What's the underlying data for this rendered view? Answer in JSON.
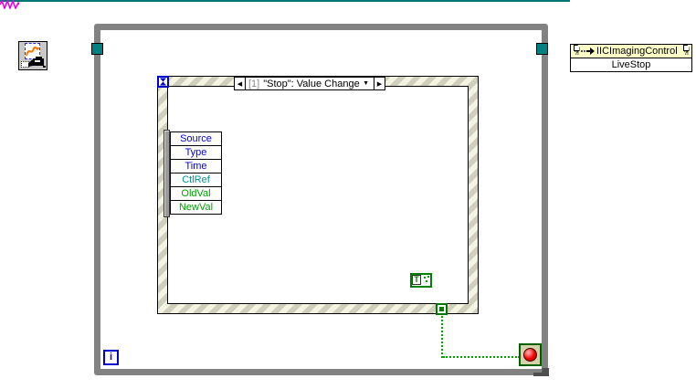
{
  "colors": {
    "refnum_wire_teal": "#007878",
    "cluster_wire_magenta": "#e800e8",
    "boolean_wire_green": "#00a300",
    "loop_border_gray": "#828282",
    "event_border_cream": "#f4f4e3",
    "event_border_stripe": "#cfcfbb",
    "invoke_header_yellow": "#ffffc8",
    "stop_button_red": "#f00000",
    "terminal_blue": "#0000cc"
  },
  "while_loop": {
    "iteration_label": "i"
  },
  "event_structure": {
    "selector": {
      "prev": "◀",
      "index": "[1]",
      "label": "\"Stop\": Value Change",
      "dropdown": "▼",
      "next": "▶"
    },
    "data_node": {
      "fields": [
        {
          "label": "Source",
          "color": "#0000e6"
        },
        {
          "label": "Type",
          "color": "#0000e6"
        },
        {
          "label": "Time",
          "color": "#0000e6"
        },
        {
          "label": "CtlRef",
          "color": "#009595"
        },
        {
          "label": "OldVal",
          "color": "#00a000"
        },
        {
          "label": "NewVal",
          "color": "#00a000"
        }
      ]
    }
  },
  "boolean_constant": {
    "value": "T"
  },
  "invoke_node": {
    "class_name": "IICImagingControl",
    "method": "LiveStop",
    "ref_glyph": "?!"
  }
}
